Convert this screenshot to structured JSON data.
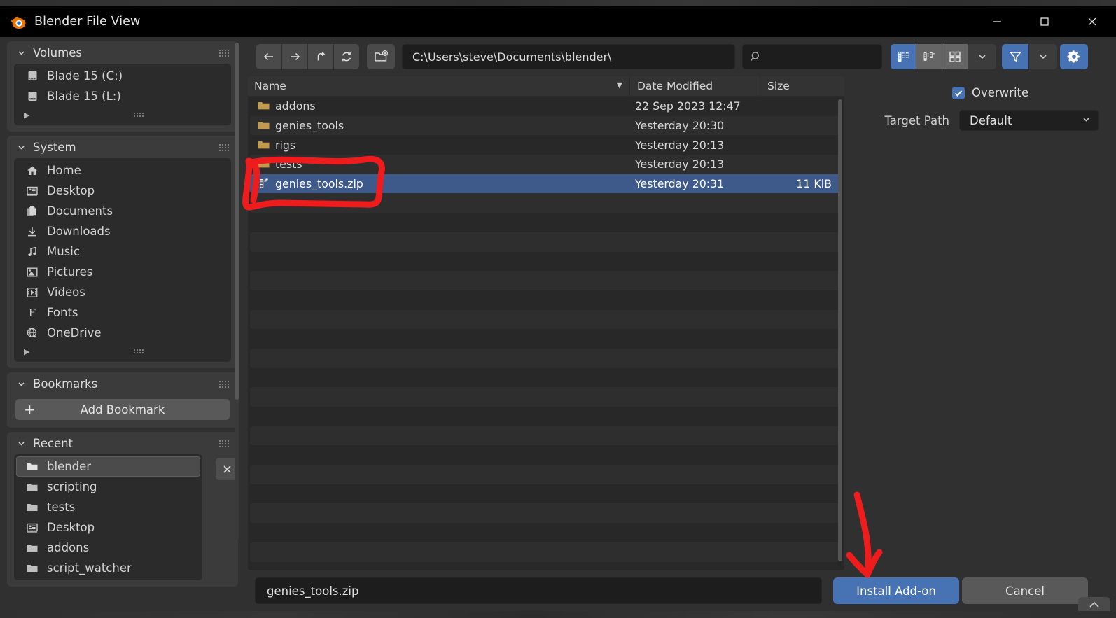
{
  "window": {
    "title": "Blender File View",
    "logo_icon": "blender-logo-icon",
    "minimize_label": "—",
    "maximize_label": "☐",
    "close_label": "✕"
  },
  "sidebar": {
    "panels": [
      {
        "name": "Volumes",
        "collapse_icon": "chevron-down-icon",
        "grip_icon": "grip-dots-icon",
        "items": [
          {
            "label": "Blade 15 (C:)",
            "icon": "disk-drive-icon"
          },
          {
            "label": "Blade 15 (L:)",
            "icon": "disk-drive-icon"
          }
        ],
        "has_more_row": true,
        "more_icon": "triangle-right-icon"
      },
      {
        "name": "System",
        "collapse_icon": "chevron-down-icon",
        "grip_icon": "grip-dots-icon",
        "items": [
          {
            "label": "Home",
            "icon": "home-icon"
          },
          {
            "label": "Desktop",
            "icon": "desktop-icon"
          },
          {
            "label": "Documents",
            "icon": "documents-icon"
          },
          {
            "label": "Downloads",
            "icon": "download-icon"
          },
          {
            "label": "Music",
            "icon": "music-note-icon"
          },
          {
            "label": "Pictures",
            "icon": "picture-icon"
          },
          {
            "label": "Videos",
            "icon": "film-icon"
          },
          {
            "label": "Fonts",
            "icon": "font-f-icon"
          },
          {
            "label": "OneDrive",
            "icon": "globe-icon"
          }
        ],
        "has_more_row": true,
        "more_icon": "triangle-right-icon"
      },
      {
        "name": "Bookmarks",
        "collapse_icon": "chevron-down-icon",
        "grip_icon": "grip-dots-icon",
        "add_button_label": "Add Bookmark",
        "add_button_icon": "plus-icon"
      },
      {
        "name": "Recent",
        "collapse_icon": "chevron-down-icon",
        "grip_icon": "grip-dots-icon",
        "clear_icon": "close-x-icon",
        "items": [
          {
            "label": "blender",
            "icon": "folder-icon",
            "selected": true
          },
          {
            "label": "scripting",
            "icon": "folder-icon",
            "selected": false
          },
          {
            "label": "tests",
            "icon": "folder-icon",
            "selected": false
          },
          {
            "label": "Desktop",
            "icon": "desktop-icon",
            "selected": false
          },
          {
            "label": "addons",
            "icon": "folder-icon",
            "selected": false
          },
          {
            "label": "script_watcher",
            "icon": "folder-icon",
            "selected": false
          }
        ]
      }
    ]
  },
  "toolbar": {
    "back_icon": "arrow-left-icon",
    "forward_icon": "arrow-right-icon",
    "up_icon": "arrow-up-parent-icon",
    "refresh_icon": "refresh-icon",
    "new_folder_icon": "new-folder-icon",
    "path_value": "C:\\Users\\steve\\Documents\\blender\\",
    "search_value": "",
    "search_placeholder": "",
    "search_icon": "search-icon",
    "view_modes": [
      {
        "icon": "vertical-list-view-icon",
        "active": true
      },
      {
        "icon": "horizontal-list-view-icon",
        "active": false
      },
      {
        "icon": "thumbnail-grid-view-icon",
        "active": false
      }
    ],
    "view_dropdown_icon": "chevron-down-icon",
    "filter_icon": "funnel-filter-icon",
    "filter_dropdown_icon": "chevron-down-icon",
    "settings_icon": "gear-icon"
  },
  "filelist": {
    "columns": [
      "Name",
      "Date Modified",
      "Size"
    ],
    "sort_indicator_icon": "triangle-down-icon",
    "rows": [
      {
        "name": "addons",
        "icon": "folder-icon",
        "date": "22 Sep 2023 12:47",
        "size": "",
        "selected": false
      },
      {
        "name": "genies_tools",
        "icon": "folder-icon",
        "date": "Yesterday 20:30",
        "size": "",
        "selected": false
      },
      {
        "name": "rigs",
        "icon": "folder-icon",
        "date": "Yesterday 20:13",
        "size": "",
        "selected": false
      },
      {
        "name": "tests",
        "icon": "folder-icon",
        "date": "Yesterday 20:13",
        "size": "",
        "selected": false
      },
      {
        "name": "genies_tools.zip",
        "icon": "zip-archive-icon",
        "date": "Yesterday 20:31",
        "size": "11 KiB",
        "selected": true
      }
    ]
  },
  "options": {
    "overwrite_label": "Overwrite",
    "overwrite_checked": true,
    "check_icon": "checkmark-icon",
    "target_path_label": "Target Path",
    "target_path_value": "Default",
    "target_path_dropdown_icon": "chevron-down-icon"
  },
  "bottom": {
    "filename_value": "genies_tools.zip",
    "install_label": "Install Add-on",
    "cancel_label": "Cancel",
    "corner_icon": "chevron-up-icon"
  },
  "annotations": {
    "highlight_shape": "red-hand-drawn-rectangle",
    "arrow_shape": "red-hand-drawn-arrow",
    "color": "#ee1c1c"
  }
}
